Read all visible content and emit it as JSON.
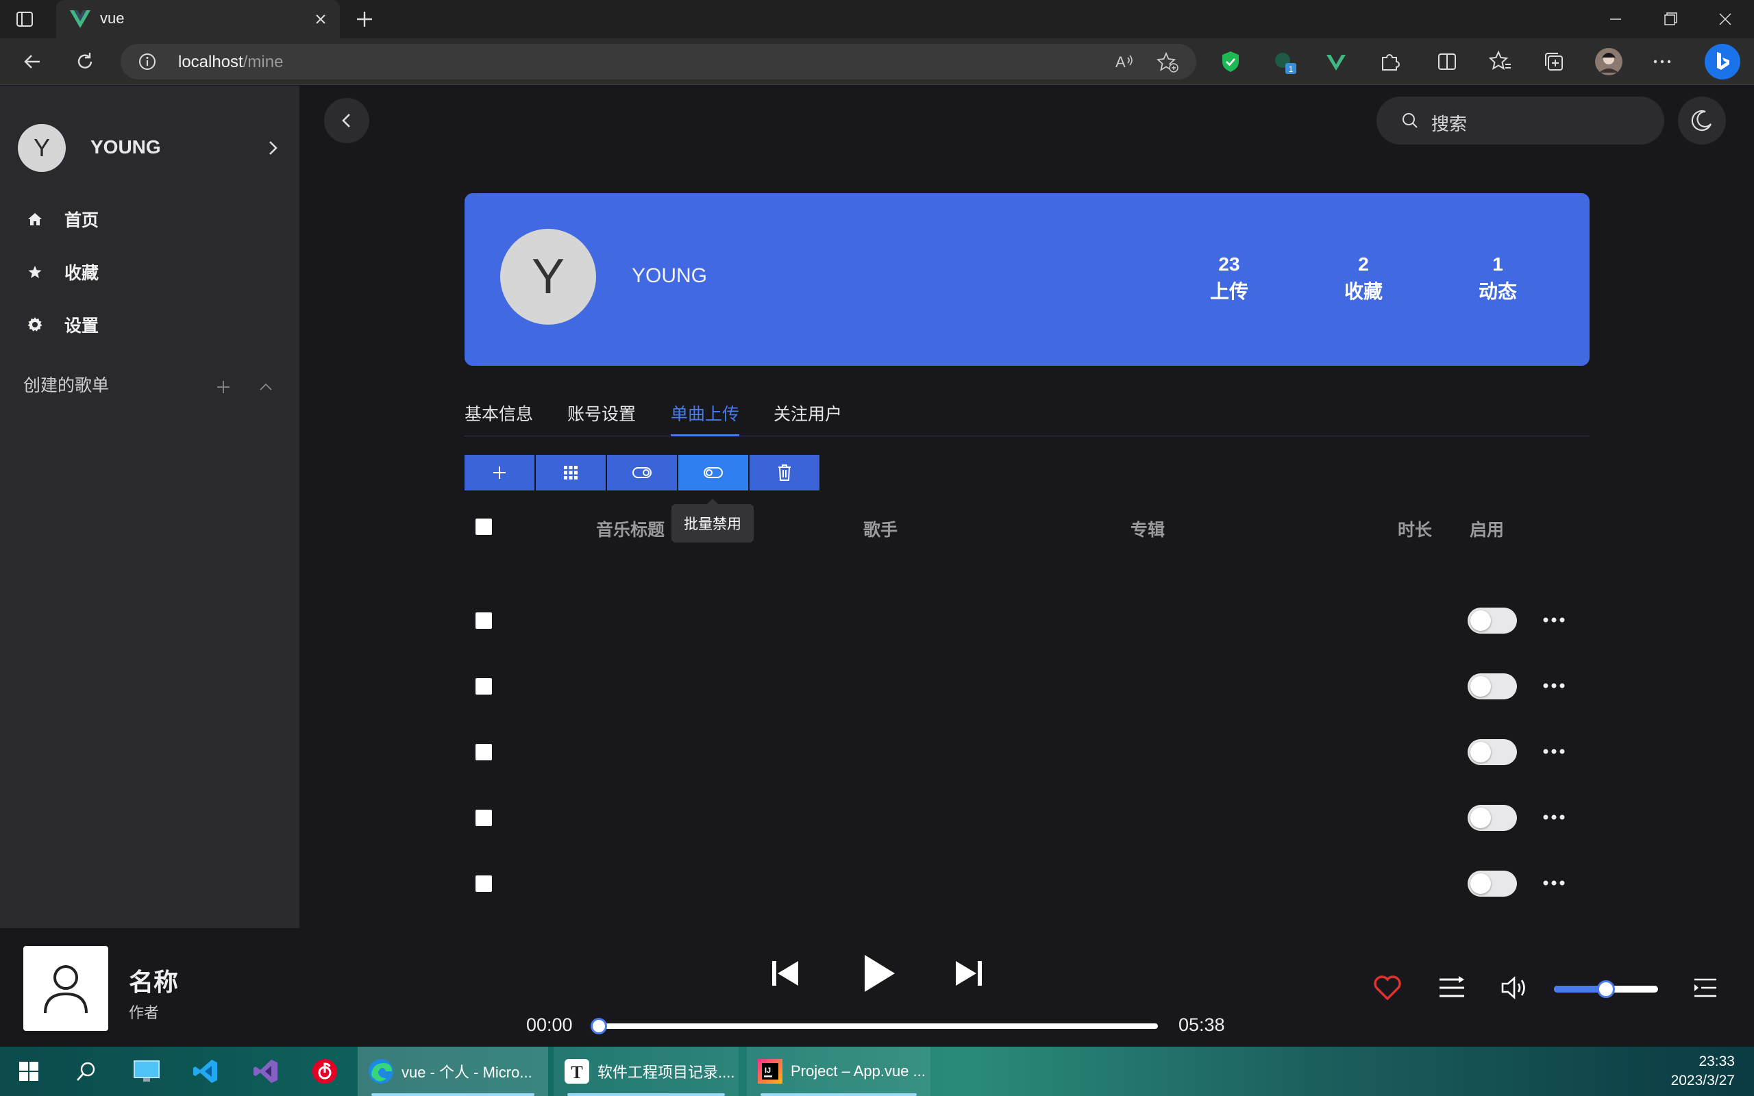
{
  "browser": {
    "tab_title": "vue",
    "url_host": "localhost",
    "url_path": "/mine",
    "extension_badge": "1"
  },
  "sidebar": {
    "user_initial": "Y",
    "user_name": "YOUNG",
    "items": [
      {
        "label": "首页",
        "icon": "home-icon"
      },
      {
        "label": "收藏",
        "icon": "star-icon"
      },
      {
        "label": "设置",
        "icon": "gear-icon"
      }
    ],
    "playlist_header": "创建的歌单"
  },
  "header": {
    "search_placeholder": "搜索"
  },
  "profile": {
    "initial": "Y",
    "name": "YOUNG",
    "stats": [
      {
        "value": "23",
        "label": "上传"
      },
      {
        "value": "2",
        "label": "收藏"
      },
      {
        "value": "1",
        "label": "动态"
      }
    ]
  },
  "tabs": [
    "基本信息",
    "账号设置",
    "单曲上传",
    "关注用户"
  ],
  "active_tab": "单曲上传",
  "toolbar": {
    "buttons": [
      "add-icon",
      "grid-icon",
      "toggle-on-icon",
      "toggle-off-icon",
      "trash-icon"
    ],
    "tooltip": "批量禁用"
  },
  "table": {
    "columns": [
      "音乐标题",
      "歌手",
      "专辑",
      "时长",
      "启用"
    ],
    "rows": [
      {
        "title": "",
        "artist": "",
        "album": "",
        "duration": "",
        "enabled": false
      },
      {
        "title": "",
        "artist": "",
        "album": "",
        "duration": "",
        "enabled": false
      },
      {
        "title": "",
        "artist": "",
        "album": "",
        "duration": "",
        "enabled": false
      },
      {
        "title": "",
        "artist": "",
        "album": "",
        "duration": "",
        "enabled": false
      },
      {
        "title": "",
        "artist": "",
        "album": "",
        "duration": "",
        "enabled": false
      }
    ]
  },
  "player": {
    "song_name": "名称",
    "artist": "作者",
    "current_time": "00:00",
    "total_time": "05:38",
    "progress": 0,
    "volume": 0.5
  },
  "taskbar": {
    "apps": [
      {
        "label": "vue - 个人 - Micro...",
        "active": true
      },
      {
        "label": "软件工程项目记录....",
        "active": false
      },
      {
        "label": "Project – App.vue ...",
        "active": false
      }
    ],
    "time": "23:33",
    "date": "2023/3/27"
  },
  "colors": {
    "accent": "#4169e1",
    "link": "#4a7bea",
    "heart": "#e0332e"
  }
}
